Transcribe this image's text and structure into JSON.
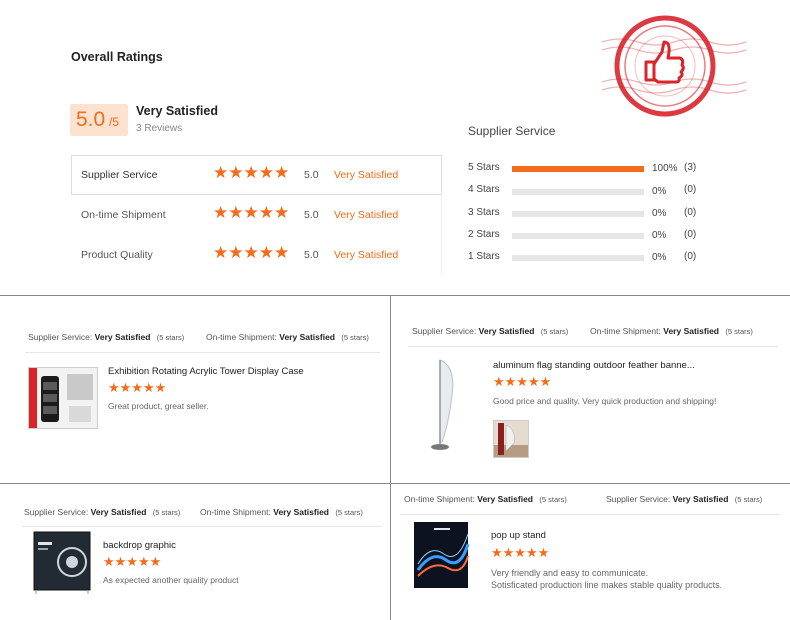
{
  "overall": {
    "heading": "Overall Ratings",
    "score": "5.0",
    "out_of": "/5",
    "verdict": "Very Satisfied",
    "reviews": "3 Reviews"
  },
  "categories": [
    {
      "label": "Supplier Service",
      "stars": "★★★★★",
      "score": "5.0",
      "verdict": "Very Satisfied"
    },
    {
      "label": "On-time Shipment",
      "stars": "★★★★★",
      "score": "5.0",
      "verdict": "Very Satisfied"
    },
    {
      "label": "Product Quality",
      "stars": "★★★★★",
      "score": "5.0",
      "verdict": "Very Satisfied"
    }
  ],
  "distribution": {
    "title": "Supplier Service",
    "rows": [
      {
        "label": "5 Stars",
        "fraction": 1.0,
        "percent": "100%",
        "count": "(3)"
      },
      {
        "label": "4 Stars",
        "fraction": 0,
        "percent": "0%",
        "count": "(0)"
      },
      {
        "label": "3 Stars",
        "fraction": 0,
        "percent": "0%",
        "count": "(0)"
      },
      {
        "label": "2 Stars",
        "fraction": 0,
        "percent": "0%",
        "count": "(0)"
      },
      {
        "label": "1 Stars",
        "fraction": 0,
        "percent": "0%",
        "count": "(0)"
      }
    ]
  },
  "reviews": [
    {
      "meta1_label": "Supplier Service:",
      "meta1_value": "Very Satisfied",
      "meta1_stars": "(5 stars)",
      "meta2_label": "On-time Shipment:",
      "meta2_value": "Very Satisfied",
      "meta2_stars": "(5 stars)",
      "product": "Exhibition Rotating Acrylic Tower Display Case",
      "stars": "★★★★★",
      "text": "Great product, great seller."
    },
    {
      "meta1_label": "Supplier Service:",
      "meta1_value": "Very Satisfied",
      "meta1_stars": "(5 stars)",
      "meta2_label": "On-time Shipment:",
      "meta2_value": "Very Satisfied",
      "meta2_stars": "(5 stars)",
      "product": "aluminum flag standing outdoor feather banne...",
      "stars": "★★★★★",
      "text": "Good price and quality. Very quick production and shipping!"
    },
    {
      "meta1_label": "Supplier Service:",
      "meta1_value": "Very Satisfied",
      "meta1_stars": "(5 stars)",
      "meta2_label": "On-time Shipment:",
      "meta2_value": "Very Satisfied",
      "meta2_stars": "(5 stars)",
      "product": "backdrop graphic",
      "stars": "★★★★★",
      "text": "As expected another quality product"
    },
    {
      "meta1_label": "On-time Shipment:",
      "meta1_value": "Very Satisfied",
      "meta1_stars": "(5 stars)",
      "meta2_label": "Supplier Service:",
      "meta2_value": "Very Satisfied",
      "meta2_stars": "(5 stars)",
      "product": "pop up stand",
      "stars": "★★★★★",
      "text": "Very friendly and easy to communicate.",
      "text2": "Sotisficated production line makes stable quality products."
    }
  ],
  "colors": {
    "accent": "#f46b1b",
    "score_bg": "#fde3cf",
    "stamp": "#d8242b"
  },
  "icons": {
    "stamp": "thumbs-up-stamp-icon"
  }
}
